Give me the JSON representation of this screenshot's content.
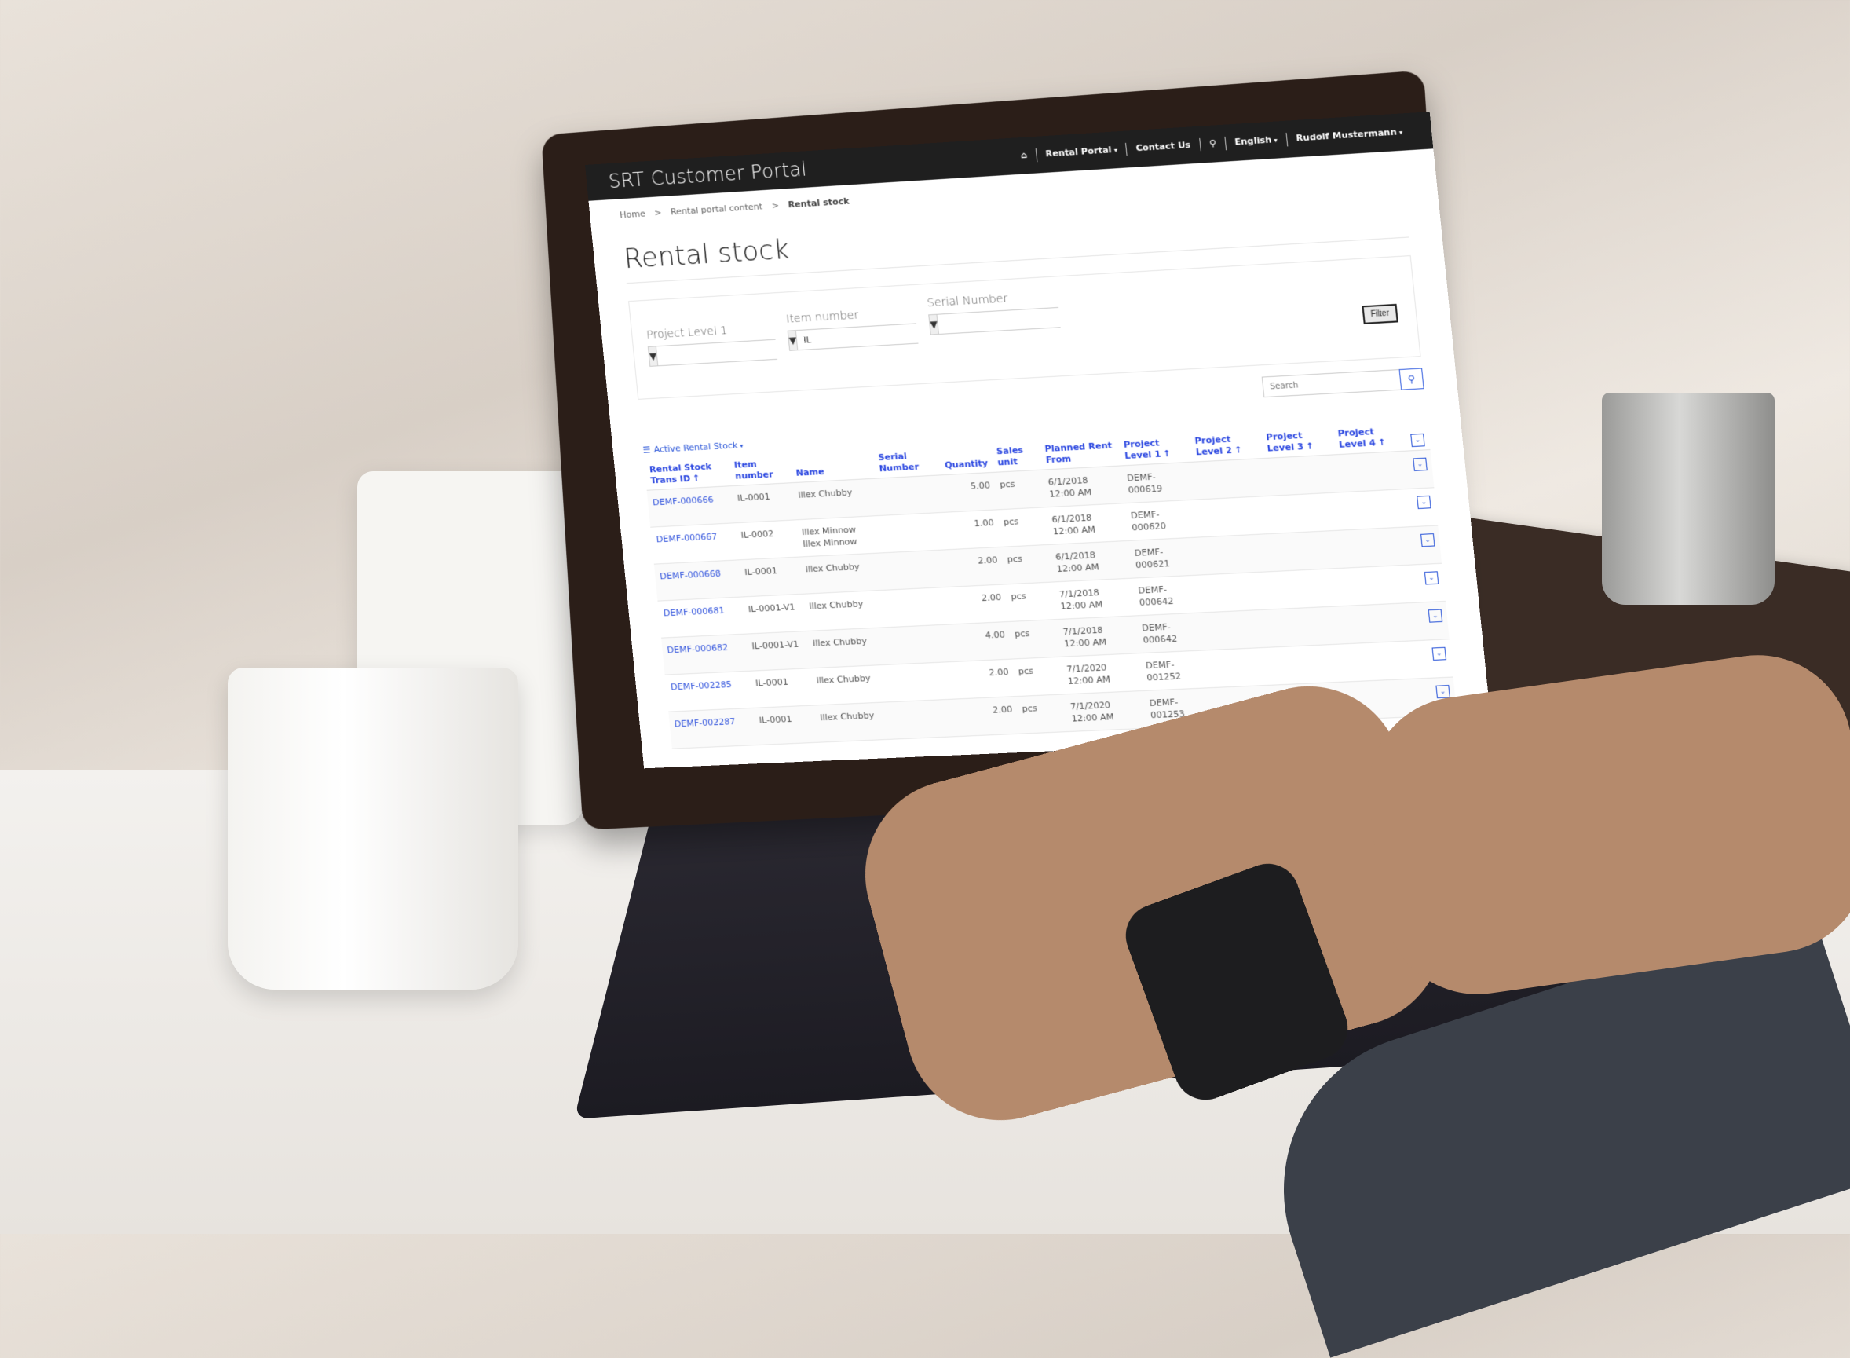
{
  "header": {
    "brand": "SRT Customer Portal",
    "nav": [
      {
        "label": "",
        "icon": "home-icon"
      },
      {
        "label": "Rental Portal",
        "dropdown": true
      },
      {
        "label": "Contact Us",
        "dropdown": false
      },
      {
        "label": "",
        "icon": "search-icon"
      },
      {
        "label": "English",
        "dropdown": true
      },
      {
        "label": "Rudolf Mustermann",
        "dropdown": true
      }
    ]
  },
  "breadcrumb": {
    "items": [
      "Home",
      "Rental portal content"
    ],
    "current": "Rental stock",
    "separator": ">"
  },
  "page": {
    "title": "Rental stock"
  },
  "filters": {
    "fields": [
      {
        "label": "Project Level 1",
        "value": ""
      },
      {
        "label": "Item number",
        "value": "IL"
      },
      {
        "label": "Serial Number",
        "value": ""
      }
    ],
    "submit_label": "Filter"
  },
  "search": {
    "placeholder": "Search"
  },
  "view": {
    "label": "Active Rental Stock"
  },
  "table": {
    "columns": [
      {
        "label": "Rental Stock Trans ID",
        "sorted": true
      },
      {
        "label": "Item number",
        "sorted": false
      },
      {
        "label": "Name",
        "sorted": false
      },
      {
        "label": "Serial Number",
        "sorted": false
      },
      {
        "label": "Quantity",
        "sorted": false
      },
      {
        "label": "Sales unit",
        "sorted": false
      },
      {
        "label": "Planned Rent From",
        "sorted": false
      },
      {
        "label": "Project Level 1",
        "sorted": true
      },
      {
        "label": "Project Level 2",
        "sorted": true
      },
      {
        "label": "Project Level 3",
        "sorted": true
      },
      {
        "label": "Project Level 4",
        "sorted": true
      }
    ],
    "rows": [
      {
        "id": "DEMF-000666",
        "item": "IL-0001",
        "name": "Illex Chubby",
        "serial": "",
        "qty": "5.00",
        "unit": "pcs",
        "date": "6/1/2018",
        "time": "12:00 AM",
        "pl1": "DEMF-000619",
        "pl2": "",
        "pl3": "",
        "pl4": ""
      },
      {
        "id": "DEMF-000667",
        "item": "IL-0002",
        "name": "Illex Minnow Illex Minnow",
        "serial": "",
        "qty": "1.00",
        "unit": "pcs",
        "date": "6/1/2018",
        "time": "12:00 AM",
        "pl1": "DEMF-000620",
        "pl2": "",
        "pl3": "",
        "pl4": ""
      },
      {
        "id": "DEMF-000668",
        "item": "IL-0001",
        "name": "Illex Chubby",
        "serial": "",
        "qty": "2.00",
        "unit": "pcs",
        "date": "6/1/2018",
        "time": "12:00 AM",
        "pl1": "DEMF-000621",
        "pl2": "",
        "pl3": "",
        "pl4": ""
      },
      {
        "id": "DEMF-000681",
        "item": "IL-0001-V1",
        "name": "Illex Chubby",
        "serial": "",
        "qty": "2.00",
        "unit": "pcs",
        "date": "7/1/2018",
        "time": "12:00 AM",
        "pl1": "DEMF-000642",
        "pl2": "",
        "pl3": "",
        "pl4": ""
      },
      {
        "id": "DEMF-000682",
        "item": "IL-0001-V1",
        "name": "Illex Chubby",
        "serial": "",
        "qty": "4.00",
        "unit": "pcs",
        "date": "7/1/2018",
        "time": "12:00 AM",
        "pl1": "DEMF-000642",
        "pl2": "",
        "pl3": "",
        "pl4": ""
      },
      {
        "id": "DEMF-002285",
        "item": "IL-0001",
        "name": "Illex Chubby",
        "serial": "",
        "qty": "2.00",
        "unit": "pcs",
        "date": "7/1/2020",
        "time": "12:00 AM",
        "pl1": "DEMF-001252",
        "pl2": "",
        "pl3": "",
        "pl4": ""
      },
      {
        "id": "DEMF-002287",
        "item": "IL-0001",
        "name": "Illex Chubby",
        "serial": "",
        "qty": "2.00",
        "unit": "pcs",
        "date": "7/1/2020",
        "time": "12:00 AM",
        "pl1": "DEMF-001253",
        "pl2": "",
        "pl3": "",
        "pl4": ""
      }
    ]
  },
  "colors": {
    "topbar": "#1f1f1f",
    "accent": "#2a46e0",
    "link": "#3355dd"
  }
}
